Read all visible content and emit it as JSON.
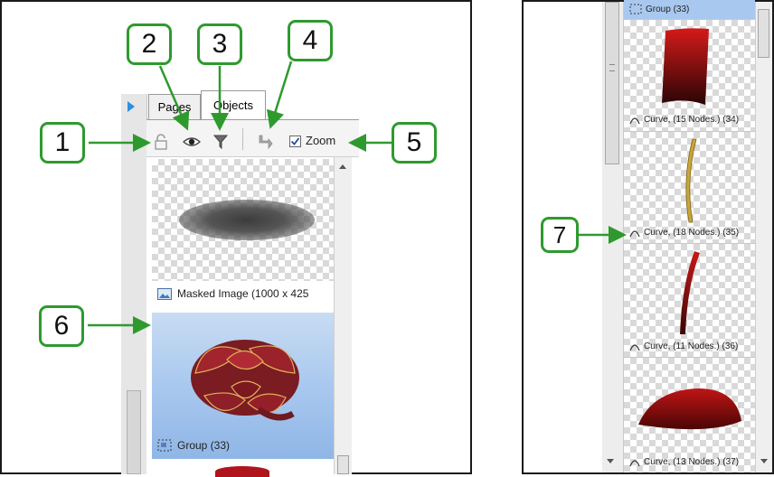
{
  "left_panel": {
    "tabs": [
      {
        "label": "Pages"
      },
      {
        "label": "Objects"
      }
    ],
    "zoom_label": "Zoom",
    "zoom_checked": true,
    "items": [
      {
        "label": "Masked Image (1000 x 425"
      },
      {
        "label": "Group (33)"
      }
    ]
  },
  "right_panel": {
    "top_partial_label": "Group (33)",
    "items": [
      {
        "label": "Curve, (15 Nodes.) (34)"
      },
      {
        "label": "Curve, (18 Nodes.) (35)"
      },
      {
        "label": "Curve, (11 Nodes.) (36)"
      },
      {
        "label": "Curve, (13 Nodes.) (37)"
      }
    ]
  },
  "callouts": [
    {
      "number": "1"
    },
    {
      "number": "2"
    },
    {
      "number": "3"
    },
    {
      "number": "4"
    },
    {
      "number": "5"
    },
    {
      "number": "6"
    },
    {
      "number": "7"
    }
  ],
  "colors": {
    "callout_green": "#2e9a2e",
    "selection_blue": "#a9c8ef",
    "ribbon_red": "#8a1a1a"
  }
}
